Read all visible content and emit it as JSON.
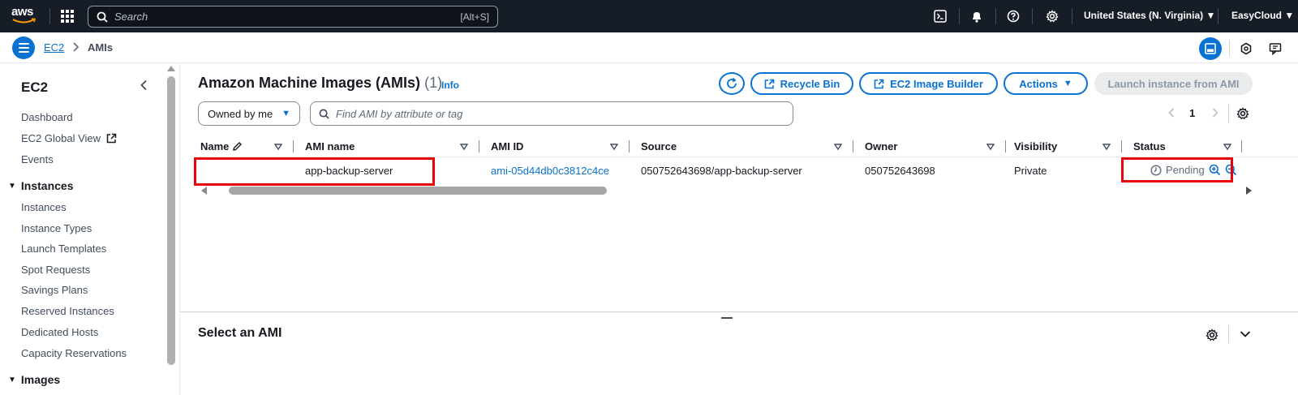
{
  "topnav": {
    "logo_text": "aws",
    "search_placeholder": "Search",
    "search_shortcut": "[Alt+S]",
    "region": "United States (N. Virginia)",
    "account": "EasyCloud",
    "icons": [
      "cloudshell-icon",
      "bell-icon",
      "help-icon",
      "gear-icon"
    ]
  },
  "breadcrumb": {
    "items": [
      "EC2"
    ],
    "current": "AMIs"
  },
  "sidebar": {
    "title": "EC2",
    "top_links": [
      "Dashboard",
      "EC2 Global View",
      "Events"
    ],
    "instances_section": "Instances",
    "instances_links": [
      "Instances",
      "Instance Types",
      "Launch Templates",
      "Spot Requests",
      "Savings Plans",
      "Reserved Instances",
      "Dedicated Hosts",
      "Capacity Reservations"
    ],
    "images_section": "Images"
  },
  "main": {
    "title": "Amazon Machine Images (AMIs)",
    "count": "(1)",
    "info": "Info",
    "buttons": {
      "recycle_bin": "Recycle Bin",
      "image_builder": "EC2 Image Builder",
      "actions": "Actions",
      "launch": "Launch instance from AMI"
    },
    "owned_filter": "Owned by me",
    "filter_placeholder": "Find AMI by attribute or tag",
    "page": "1",
    "columns": [
      "Name",
      "AMI name",
      "AMI ID",
      "Source",
      "Owner",
      "Visibility",
      "Status"
    ],
    "rows": [
      {
        "name": "",
        "ami_name": "app-backup-server",
        "ami_id": "ami-05d44db0c3812c4ce",
        "source": "050752643698/app-backup-server",
        "owner": "050752643698",
        "visibility": "Private",
        "status": "Pending"
      }
    ],
    "split_title": "Select an AMI"
  },
  "colors": {
    "accent": "#0972d3",
    "nav_bg": "#161d26",
    "highlight": "#e8000b"
  }
}
